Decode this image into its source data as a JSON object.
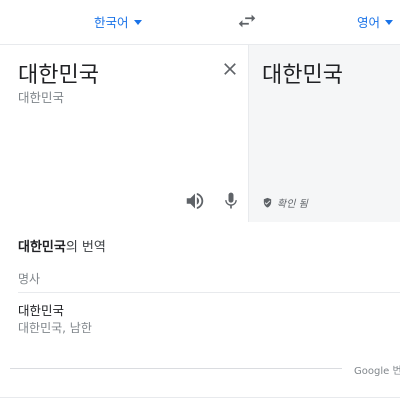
{
  "language_bar": {
    "source_language": "한국어",
    "target_language": "영어"
  },
  "source": {
    "text": "대한민국",
    "transliteration": "대한민국"
  },
  "target": {
    "text": "대한민국",
    "verified_label": "확인 됨"
  },
  "translations": {
    "heading_word": "대한민국",
    "heading_suffix": "의 번역",
    "part_of_speech": "명사",
    "entries": [
      {
        "word": "대한민국",
        "synonyms": "대한민국, 남한"
      }
    ]
  },
  "footer": {
    "brand_text": "Google 번역"
  },
  "colors": {
    "accent": "#1a73e8",
    "target_pane_bg": "#f5f6f7",
    "muted_text": "#80868b"
  },
  "icons": [
    "chevron-down-icon",
    "swap-languages-icon",
    "close-icon",
    "speaker-icon",
    "mic-icon",
    "verified-check-icon"
  ]
}
